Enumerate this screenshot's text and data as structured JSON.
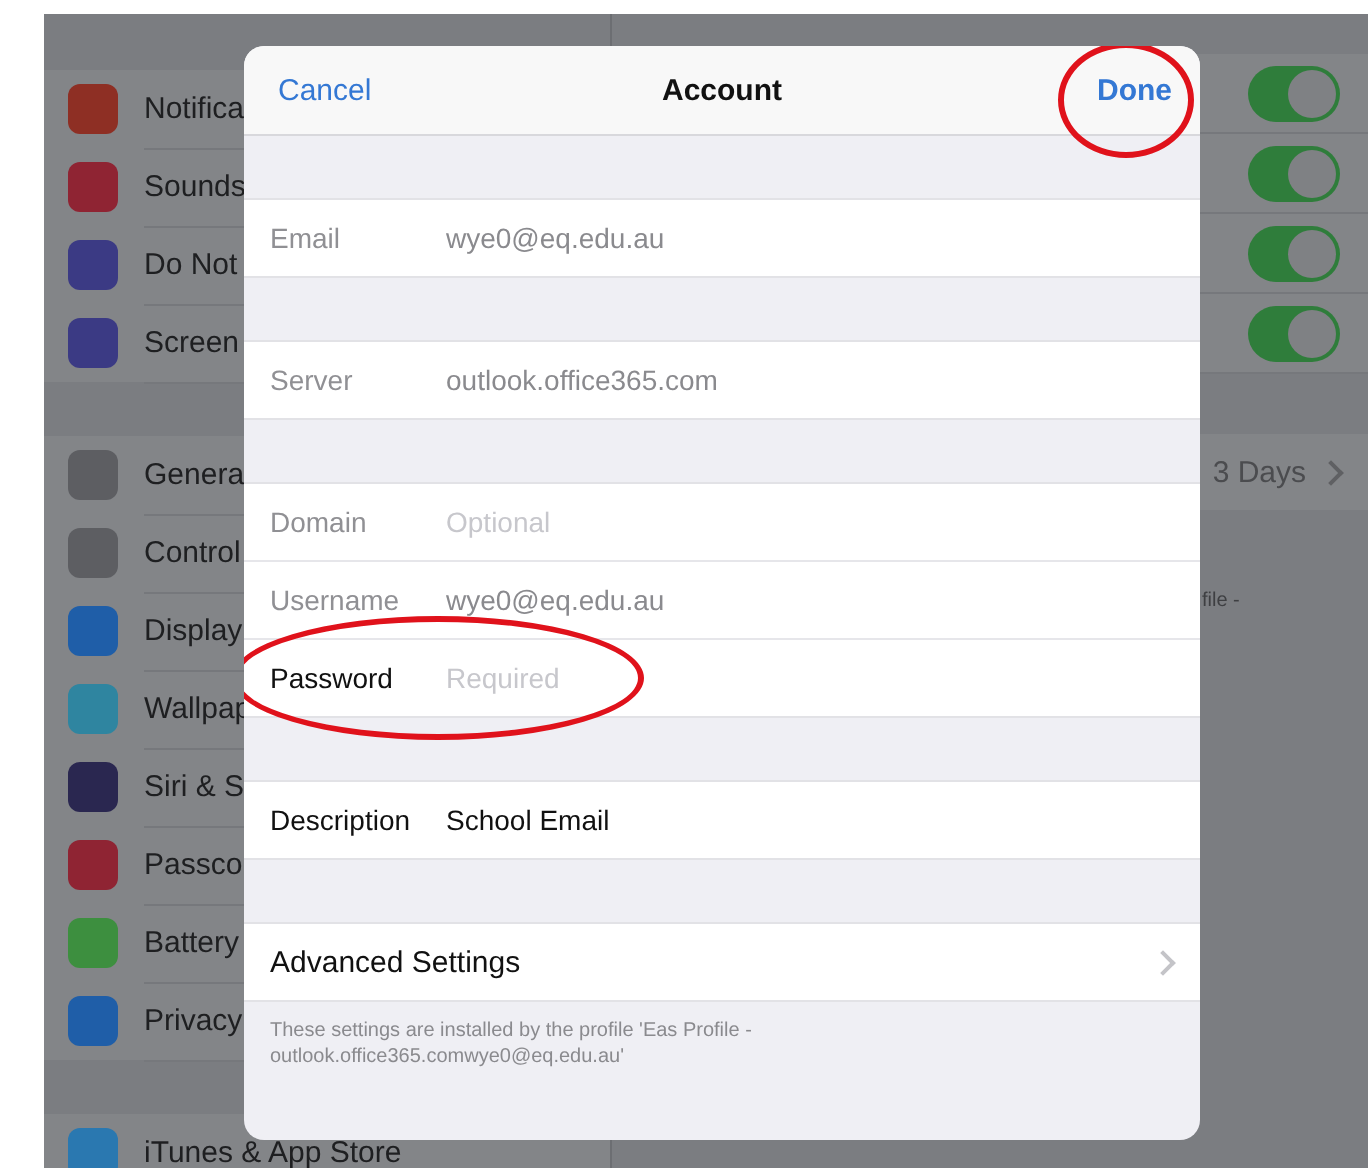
{
  "sidebar": {
    "groups": [
      {
        "items": [
          {
            "label": "Notifica",
            "color": "#8e2f24"
          },
          {
            "label": "Sounds",
            "color": "#8f2433"
          },
          {
            "label": "Do Not",
            "color": "#3b3a84"
          },
          {
            "label": "Screen",
            "color": "#3b3a84"
          }
        ]
      },
      {
        "items": [
          {
            "label": "Genera",
            "color": "#5d5e62"
          },
          {
            "label": "Control",
            "color": "#5d5e62"
          },
          {
            "label": "Display",
            "color": "#1f5ea8"
          },
          {
            "label": "Wallpap",
            "color": "#2f85a0"
          },
          {
            "label": "Siri & S",
            "color": "#2a2750"
          },
          {
            "label": "Passco",
            "color": "#8f2433"
          },
          {
            "label": "Battery",
            "color": "#3d8f3f"
          },
          {
            "label": "Privacy",
            "color": "#1f5ea8"
          }
        ]
      },
      {
        "items": [
          {
            "label": "iTunes & App Store",
            "color": "#2a78b0"
          }
        ]
      }
    ]
  },
  "detail": {
    "toggles": [
      {
        "on": true
      },
      {
        "on": true
      },
      {
        "on": true
      },
      {
        "on": true
      }
    ],
    "value_row": {
      "value": "3 Days"
    },
    "note": "file -"
  },
  "modal": {
    "title": "Account",
    "cancel": "Cancel",
    "done": {
      "label": "Done",
      "circled": true
    },
    "sections": [
      {
        "rows": [
          {
            "label": "Email",
            "value": "wye0@eq.edu.au",
            "disabled": true
          }
        ]
      },
      {
        "rows": [
          {
            "label": "Server",
            "value": "outlook.office365.com",
            "disabled": true
          }
        ]
      },
      {
        "rows": [
          {
            "label": "Domain",
            "placeholder": "Optional",
            "disabled": true
          },
          {
            "label": "Username",
            "value": "wye0@eq.edu.au",
            "disabled": true
          },
          {
            "label": "Password",
            "placeholder": "Required",
            "disabled": false,
            "circled": true
          }
        ]
      },
      {
        "rows": [
          {
            "label": "Description",
            "value": "School Email",
            "disabled": false
          }
        ]
      }
    ],
    "advanced": {
      "label": "Advanced Settings"
    },
    "footer": "These settings are installed by the profile 'Eas Profile -\noutlook.office365.comwye0@eq.edu.au'"
  }
}
